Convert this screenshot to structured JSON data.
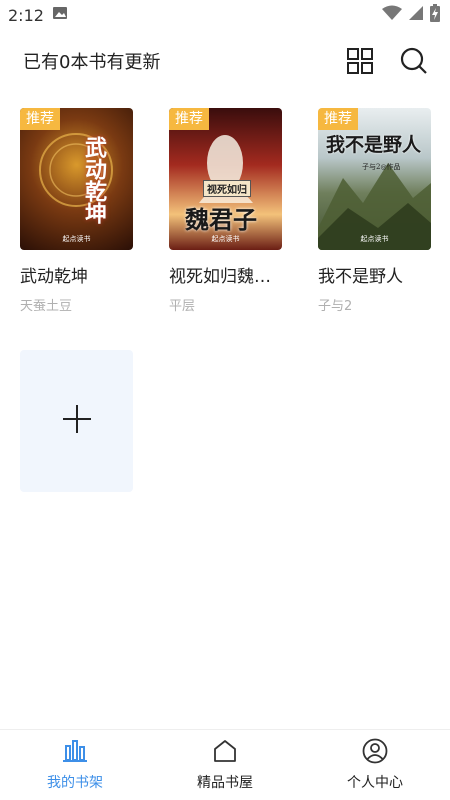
{
  "status_bar": {
    "time": "2:12"
  },
  "header": {
    "title": "已有0本书有更新"
  },
  "shelf": {
    "books": [
      {
        "badge": "推荐",
        "title": "武动乾坤",
        "author": "天蚕土豆",
        "cover_text": "武动乾坤",
        "publisher": "起点读书"
      },
      {
        "badge": "推荐",
        "title": "视死如归魏君子",
        "author": "平层",
        "cover_text": "魏君子",
        "cover_subtext": "视死如归",
        "publisher": "起点读书"
      },
      {
        "badge": "推荐",
        "title": "我不是野人",
        "author": "子与2",
        "cover_text": "我不是野人",
        "cover_subtext": "子与2◎作品",
        "publisher": "起点读书"
      }
    ]
  },
  "bottom_nav": {
    "items": [
      {
        "label": "我的书架",
        "active": true
      },
      {
        "label": "精品书屋",
        "active": false
      },
      {
        "label": "个人中心",
        "active": false
      }
    ]
  },
  "colors": {
    "accent": "#3d8fe8",
    "badge": "#f6b840",
    "add_tile": "#f1f6fd"
  }
}
